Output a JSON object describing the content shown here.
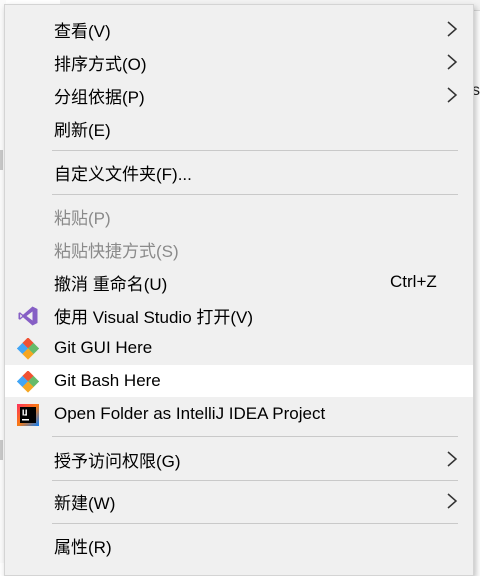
{
  "background": {
    "fragment_text": "s"
  },
  "menu": {
    "items": [
      {
        "label": "查看(V)",
        "submenu": true
      },
      {
        "label": "排序方式(O)",
        "submenu": true
      },
      {
        "label": "分组依据(P)",
        "submenu": true
      },
      {
        "label": "刷新(E)"
      },
      {
        "label": "自定义文件夹(F)..."
      },
      {
        "label": "粘贴(P)",
        "disabled": true
      },
      {
        "label": "粘贴快捷方式(S)",
        "disabled": true
      },
      {
        "label": "撤消 重命名(U)",
        "shortcut": "Ctrl+Z"
      },
      {
        "label": "使用 Visual Studio 打开(V)",
        "icon": "visual-studio-icon"
      },
      {
        "label": "Git GUI Here",
        "icon": "git-gui-icon"
      },
      {
        "label": "Git Bash Here",
        "icon": "git-bash-icon",
        "highlighted": true
      },
      {
        "label": "Open Folder as IntelliJ IDEA Project",
        "icon": "intellij-idea-icon"
      },
      {
        "label": "授予访问权限(G)",
        "submenu": true
      },
      {
        "label": "新建(W)",
        "submenu": true
      },
      {
        "label": "属性(R)"
      }
    ]
  },
  "colors": {
    "menu_background": "#f0f0f0",
    "highlight": "#ffffff",
    "separator": "#c9c9c9",
    "disabled_text": "#8a8a8a",
    "visual_studio_purple": "#865fc5",
    "git_orange": "#f05133",
    "git_green": "#66bb6a",
    "git_blue": "#42a5f5"
  }
}
